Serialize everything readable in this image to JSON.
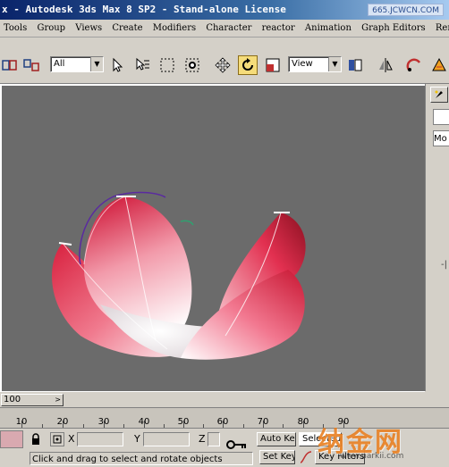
{
  "window": {
    "title": "x - Autodesk 3ds Max 8 SP2  - Stand-alone License",
    "site_badge": "665.JCWCN.COM"
  },
  "menu": {
    "items": [
      "Tools",
      "Group",
      "Views",
      "Create",
      "Modifiers",
      "Character",
      "reactor",
      "Animation",
      "Graph Editors",
      "Renderi"
    ]
  },
  "toolbar": {
    "selection_filter": "All",
    "reference_coord": "View",
    "icons": [
      "link-icon",
      "unlink-icon",
      "select-arrow-icon",
      "select-by-name-icon",
      "rect-region-icon",
      "window-crossing-icon",
      "move-icon",
      "rotate-icon",
      "scale-icon",
      "named-sets-icon",
      "mirror-icon",
      "align-icon",
      "curve-editor-icon"
    ]
  },
  "command_panel": {
    "modifier_list_text": "Mo"
  },
  "timeline": {
    "frame_display": "100",
    "ruler_labels": [
      "10",
      "20",
      "30",
      "40",
      "50",
      "60",
      "70",
      "80",
      "90"
    ]
  },
  "status": {
    "x_label": "X",
    "y_label": "Y",
    "z_label": "Z",
    "auto_key": "Auto Key",
    "set_key": "Set Key",
    "selected": "Selected",
    "key_filters": "Key Filters...",
    "prompt": "Click and drag to select and rotate objects"
  },
  "watermark": {
    "text": "纳金网",
    "url": "www.narkii.com"
  },
  "colors": {
    "viewport_bg": "#6b6b6b",
    "petal": "#e8304e",
    "title_bar": "#0a246a",
    "active_tool": "#f5dc7a"
  }
}
